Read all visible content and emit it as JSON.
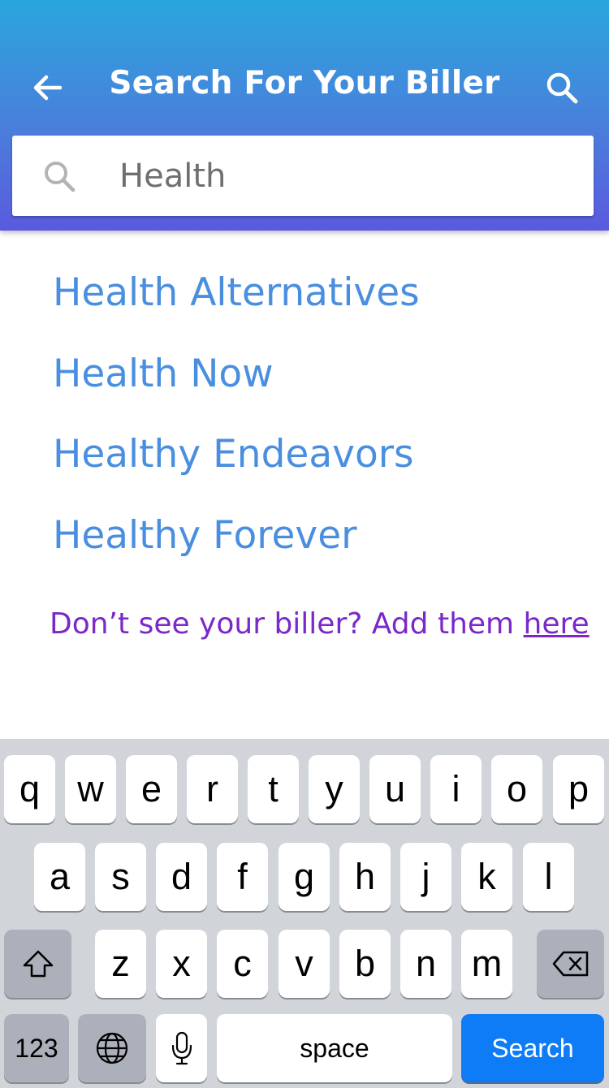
{
  "header": {
    "title": "Search For Your Biller",
    "back_icon": "arrow-left-icon",
    "search_icon": "search-icon"
  },
  "search": {
    "value": "Health",
    "placeholder": "",
    "icon": "search-icon"
  },
  "results": [
    {
      "label": "Health Alternatives"
    },
    {
      "label": "Health Now"
    },
    {
      "label": "Healthy Endeavors"
    },
    {
      "label": "Healthy Forever"
    }
  ],
  "add_biller": {
    "text": "Don’t see your biller? Add them ",
    "link": "here"
  },
  "keyboard": {
    "row1": [
      "q",
      "w",
      "e",
      "r",
      "t",
      "y",
      "u",
      "i",
      "o",
      "p"
    ],
    "row2": [
      "a",
      "s",
      "d",
      "f",
      "g",
      "h",
      "j",
      "k",
      "l"
    ],
    "row3": [
      "z",
      "x",
      "c",
      "v",
      "b",
      "n",
      "m"
    ],
    "shift_icon": "shift-icon",
    "backspace_icon": "backspace-icon",
    "numbers_label": "123",
    "globe_icon": "globe-icon",
    "mic_icon": "microphone-icon",
    "space_label": "space",
    "search_label": "Search"
  },
  "colors": {
    "header_top": "#2aa6dc",
    "header_bottom": "#5b5adf",
    "result_text": "#4a8fdf",
    "note_text": "#7a28c9",
    "search_key": "#0f7cf7"
  }
}
